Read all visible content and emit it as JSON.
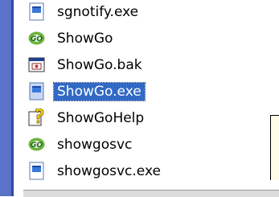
{
  "file_list": {
    "items": [
      {
        "name": "sgnotify.exe",
        "icon": "exe-file-icon",
        "selected": false
      },
      {
        "name": "ShowGo",
        "icon": "showgo-app-icon",
        "selected": false
      },
      {
        "name": "ShowGo.bak",
        "icon": "bak-file-icon",
        "selected": false
      },
      {
        "name": "ShowGo.exe",
        "icon": "exe-file-icon",
        "selected": true
      },
      {
        "name": "ShowGoHelp",
        "icon": "help-file-icon",
        "selected": false
      },
      {
        "name": "showgosvc",
        "icon": "showgo-app-icon",
        "selected": false
      },
      {
        "name": "showgosvc.exe",
        "icon": "exe-file-icon",
        "selected": false
      }
    ]
  },
  "colors": {
    "selection": "#316ac5",
    "sidebar_strip": "#5a73c8"
  }
}
